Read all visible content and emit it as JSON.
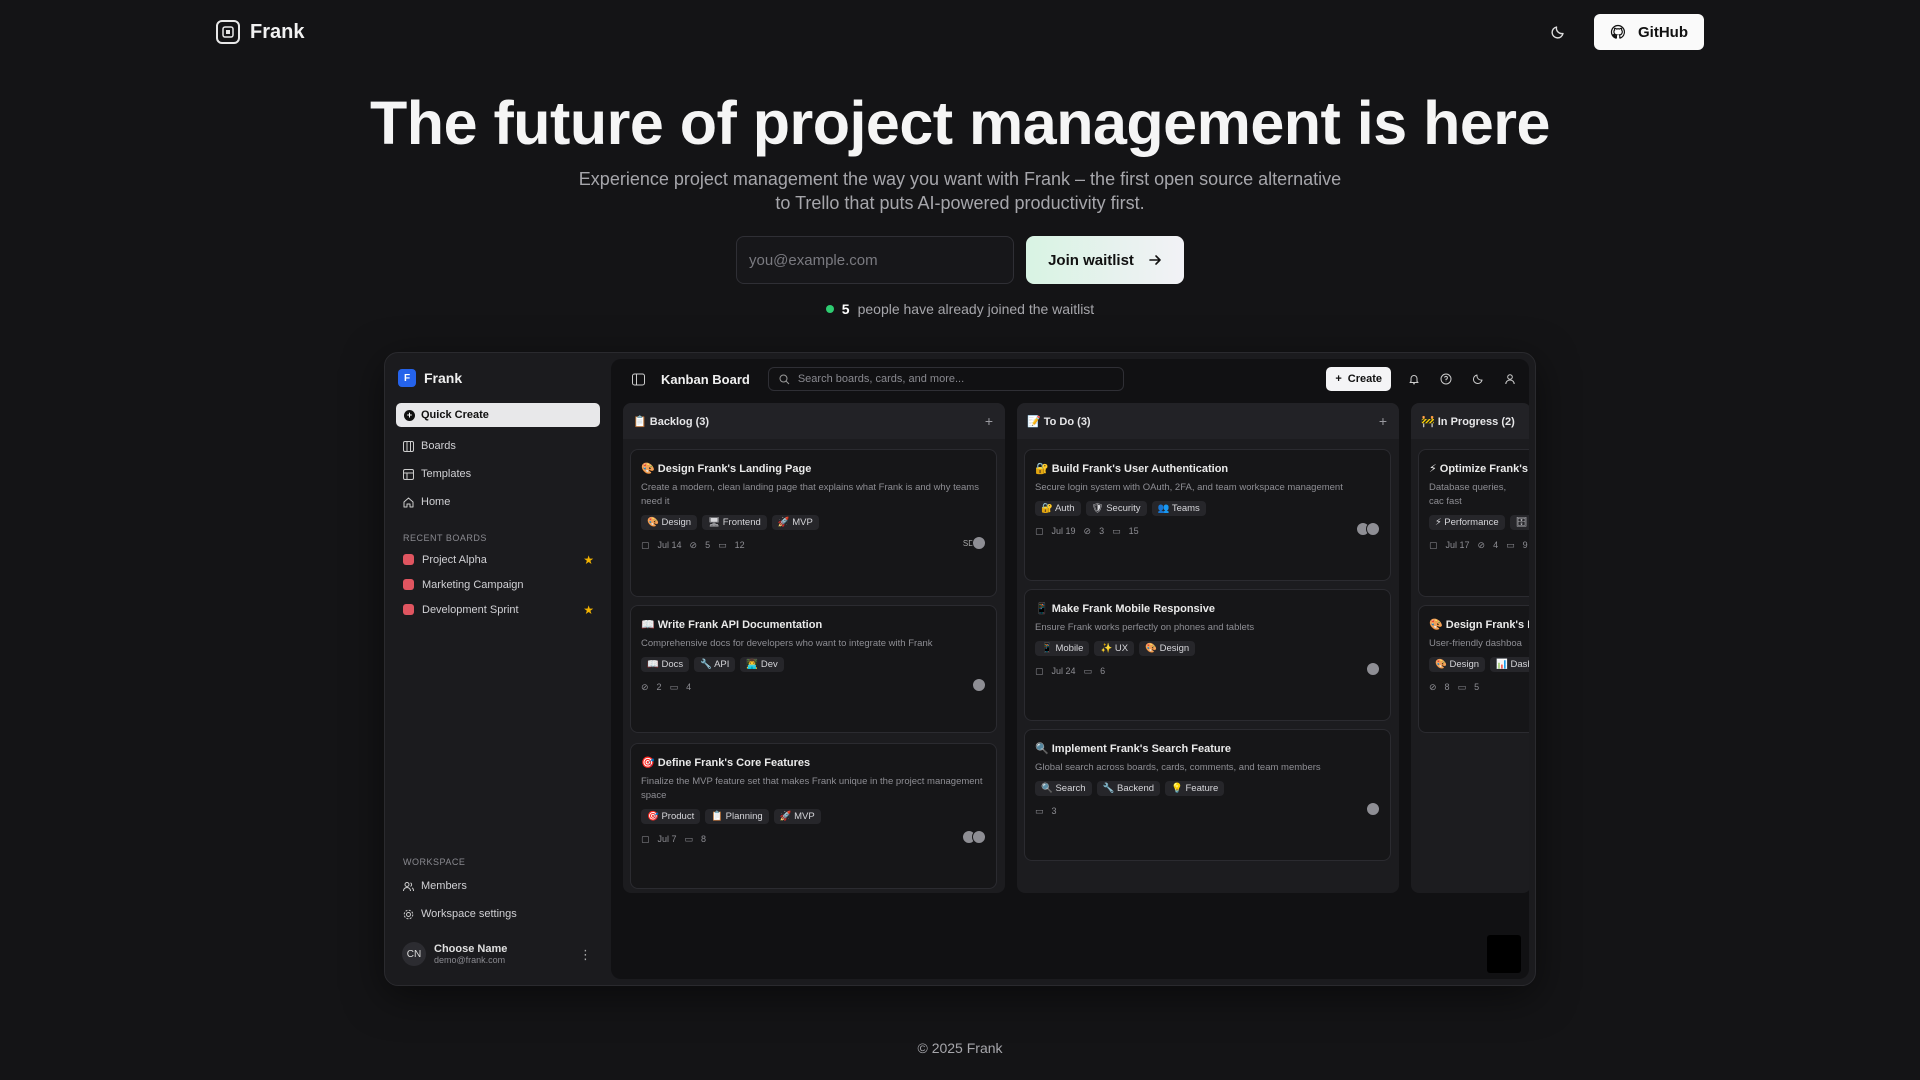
{
  "nav": {
    "brand": "Frank",
    "github_label": "GitHub"
  },
  "hero": {
    "title": "The future of project management is here",
    "subtitle_line1": "Experience project management the way you want with Frank – the first open source alternative",
    "subtitle_line2": "to Trello that puts AI-powered productivity first.",
    "email_placeholder": "you@example.com",
    "join_label": "Join waitlist",
    "waitlist_count": "5",
    "waitlist_text": "people have already joined the waitlist"
  },
  "app": {
    "brand": "Frank",
    "logo_letter": "F",
    "quick_create": "Quick Create",
    "nav": [
      {
        "label": "Boards",
        "icon": "boards-icon"
      },
      {
        "label": "Templates",
        "icon": "templates-icon"
      },
      {
        "label": "Home",
        "icon": "home-icon"
      }
    ],
    "recent_boards_title": "RECENT BOARDS",
    "recent_boards": [
      {
        "label": "Project Alpha",
        "starred": true
      },
      {
        "label": "Marketing Campaign",
        "starred": false
      },
      {
        "label": "Development Sprint",
        "starred": true
      }
    ],
    "workspace_title": "WORKSPACE",
    "workspace_items": [
      {
        "label": "Members"
      },
      {
        "label": "Workspace settings"
      }
    ],
    "user": {
      "initials": "CN",
      "name": "Choose Name",
      "email": "demo@frank.com"
    },
    "topbar": {
      "title": "Kanban Board",
      "search_placeholder": "Search boards, cards, and more...",
      "create_label": "Create"
    },
    "columns": [
      {
        "title": "📋 Backlog (3)",
        "cards": [
          {
            "title": "🎨 Design Frank's Landing Page",
            "desc": "Create a modern, clean landing page that explains what Frank is and why teams need it",
            "tags": [
              "🎨 Design",
              "🖥 Frontend",
              "🚀 MVP"
            ],
            "date": "Jul 14",
            "attachments": "5",
            "comments": "12",
            "avatar_text": "SD"
          },
          {
            "title": "📖 Write Frank API Documentation",
            "desc": "Comprehensive docs for developers who want to integrate with Frank",
            "tags": [
              "📖 Docs",
              "🔧 API",
              "👨‍💻 Dev"
            ],
            "date": "",
            "attachments": "2",
            "comments": "4",
            "avatar_text": ""
          },
          {
            "title": "🎯 Define Frank's Core Features",
            "desc": "Finalize the MVP feature set that makes Frank unique in the project management space",
            "tags": [
              "🎯 Product",
              "📋 Planning",
              "🚀 MVP"
            ],
            "date": "Jul 7",
            "attachments": "",
            "comments": "8",
            "avatar_text": ""
          }
        ]
      },
      {
        "title": "📝 To Do (3)",
        "cards": [
          {
            "title": "🔐 Build Frank's User Authentication",
            "desc": "Secure login system with OAuth, 2FA, and team workspace management",
            "tags": [
              "🔐 Auth",
              "🛡 Security",
              "👥 Teams"
            ],
            "date": "Jul 19",
            "attachments": "3",
            "comments": "15",
            "avatar_text": ""
          },
          {
            "title": "📱 Make Frank Mobile Responsive",
            "desc": "Ensure Frank works perfectly on phones and tablets",
            "tags": [
              "📱 Mobile",
              "✨ UX",
              "🎨 Design"
            ],
            "date": "Jul 24",
            "attachments": "",
            "comments": "6",
            "avatar_text": ""
          },
          {
            "title": "🔍 Implement Frank's Search Feature",
            "desc": "Global search across boards, cards, comments, and team members",
            "tags": [
              "🔍 Search",
              "🔧 Backend",
              "💡 Feature"
            ],
            "date": "",
            "attachments": "",
            "comments": "3",
            "avatar_text": ""
          }
        ]
      },
      {
        "title": "🚧 In Progress (2)",
        "cards": [
          {
            "title": "⚡ Optimize Frank's",
            "desc": "Database queries, cac fast",
            "tags": [
              "⚡ Performance",
              "🗄"
            ],
            "date": "Jul 17",
            "attachments": "4",
            "comments": "9",
            "avatar_text": ""
          },
          {
            "title": "🎨 Design Frank's D",
            "desc": "User-friendly dashboa",
            "tags": [
              "🎨 Design",
              "📊 Dash"
            ],
            "date": "",
            "attachments": "8",
            "comments": "5",
            "avatar_text": ""
          }
        ]
      }
    ]
  },
  "footer": {
    "text": "© 2025 Frank"
  },
  "colors": {
    "background": "#141416",
    "accent_blue": "#2563eb",
    "board_red": "#e05560",
    "star": "#f4b400",
    "online_dot": "#2ecc71"
  }
}
